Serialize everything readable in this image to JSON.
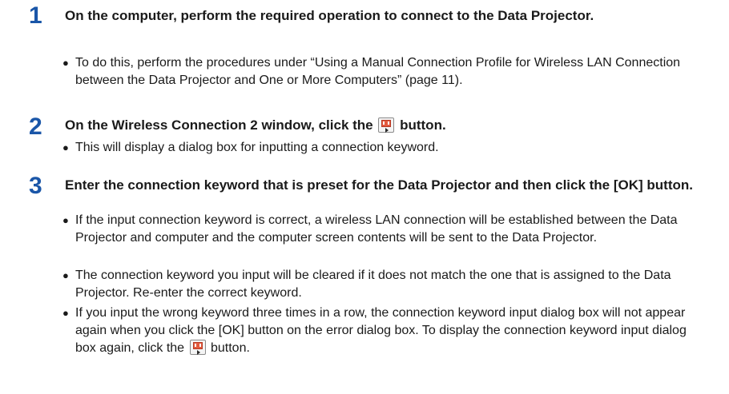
{
  "steps": [
    {
      "number": "1",
      "title": "On the computer, perform the required operation to connect to the Data Projector.",
      "bullets": [
        "To do this, perform the procedures under “Using a Manual Connection Profile for Wireless LAN Connection between the Data Projector and One or More Computers” (page 11)."
      ]
    },
    {
      "number": "2",
      "title_before": "On the Wireless Connection 2 window, click the",
      "title_after": "button.",
      "bullets": [
        "This will display a dialog box for inputting a connection keyword."
      ]
    },
    {
      "number": "3",
      "title": "Enter the connection keyword that is preset for the Data Projector and then click the [OK] button.",
      "bullets": [
        "If the input connection keyword is correct, a wireless LAN connection will be established between the Data Projector and computer and the computer screen contents will be sent to the Data Projector.",
        "The connection keyword you input will be cleared if it does not match the one that is assigned to the Data Projector. Re-enter the correct keyword."
      ],
      "last_bullet_before": "If you input the wrong keyword three times in a row, the connection keyword input dialog box will not appear again when you click the [OK] button on the error dialog box. To display the connection keyword input dialog box again, click the",
      "last_bullet_after": "button."
    }
  ],
  "icons": {
    "bullet": "bullet-dot-icon",
    "projector_button": "wireless-projection-icon"
  }
}
